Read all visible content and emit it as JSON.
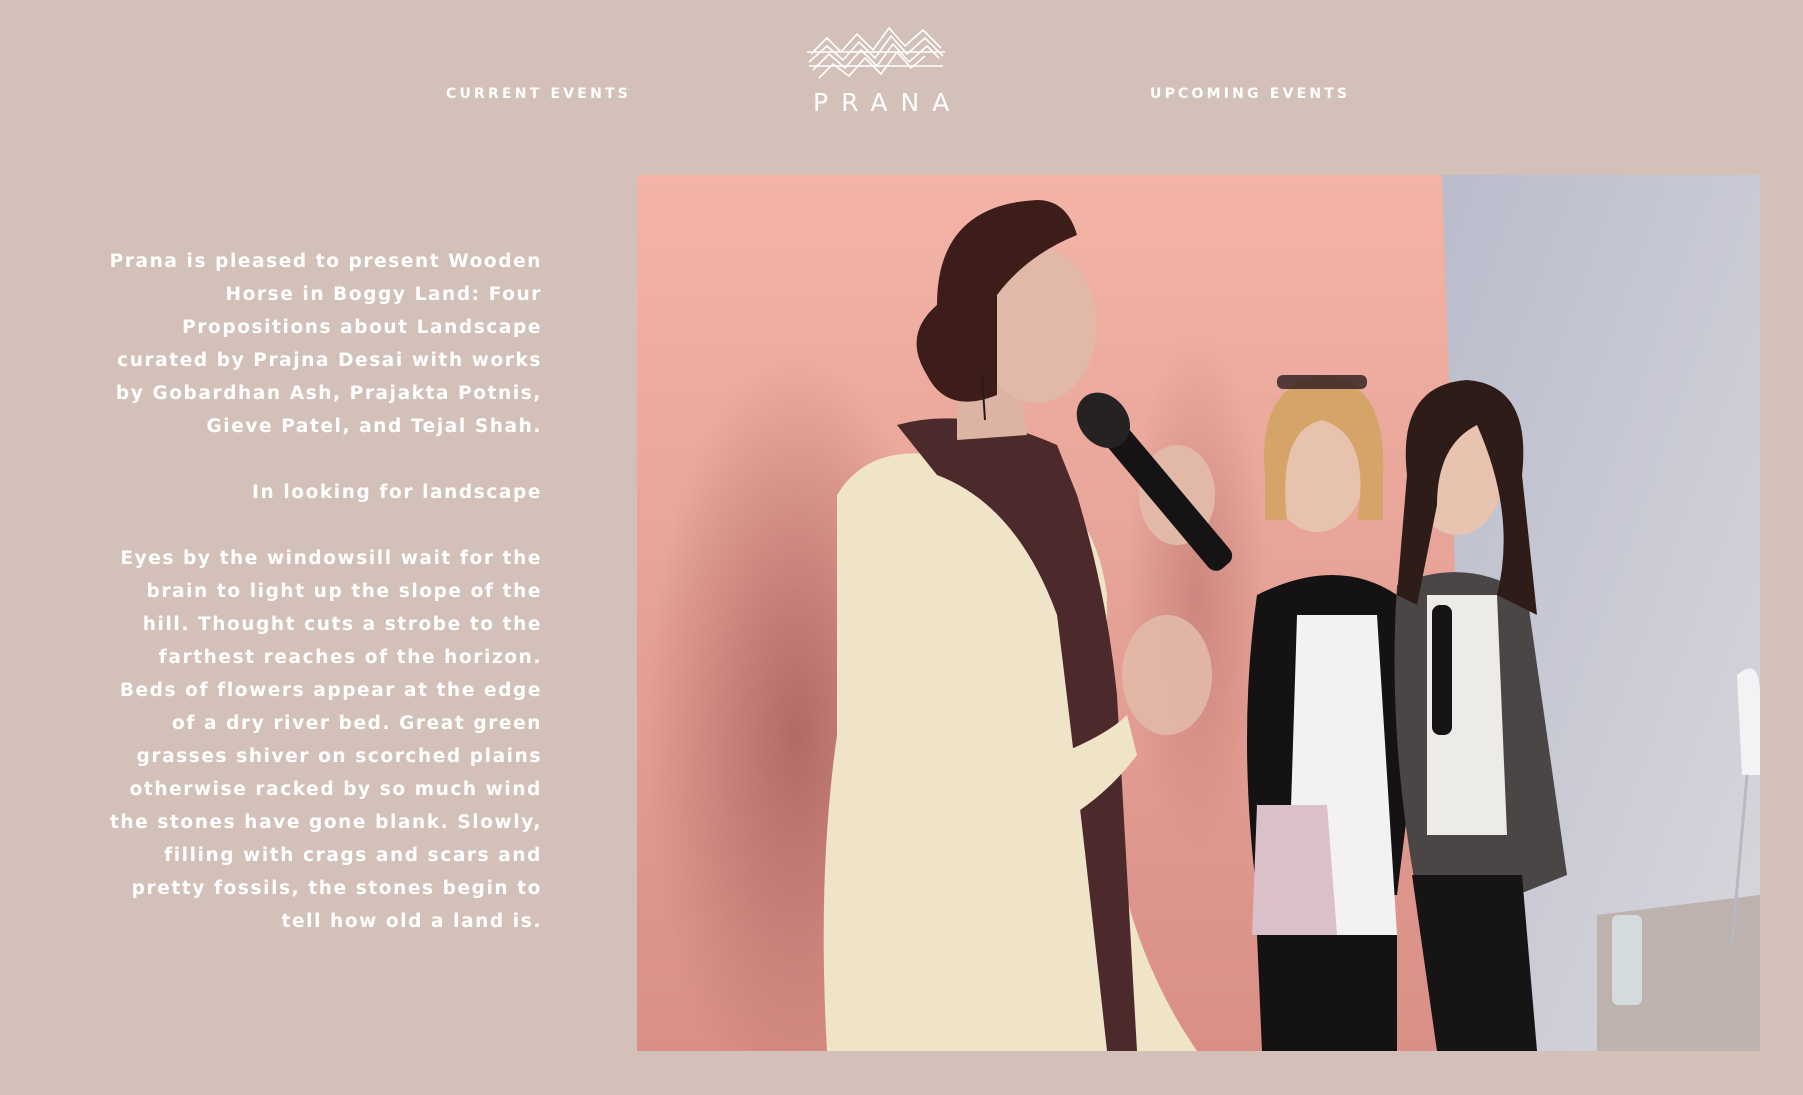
{
  "nav": {
    "current_events": "CURRENT EVENTS",
    "upcoming_events": "UPCOMING EVENTS"
  },
  "logo": {
    "text": "PRANA",
    "icon": "mountain-waves-logo-icon"
  },
  "intro": {
    "paragraph1": "Prana is pleased to present Wooden Horse in Boggy Land: Four Propositions about Landscape curated by Prajna Desai with works by Gobardhan Ash, Prajakta Potnis, Gieve Patel, and Tejal Shah.",
    "paragraph2": "In looking for landscape",
    "paragraph3": "Eyes by the windowsill wait for the brain to light up the slope of the hill. Thought cuts a strobe to the farthest reaches of the horizon. Beds of flowers appear at the edge of a dry river bed. Great green grasses shiver on scorched plains otherwise racked by so much wind the stones have gone blank. Slowly, filling with crags and scars and pretty fossils, the stones begin to tell how old a land is."
  },
  "colors": {
    "background": "#d3c1b9",
    "text": "#ffffff",
    "pink_wall": "#e6a89a",
    "grey_wall": "#c7c4cc"
  }
}
